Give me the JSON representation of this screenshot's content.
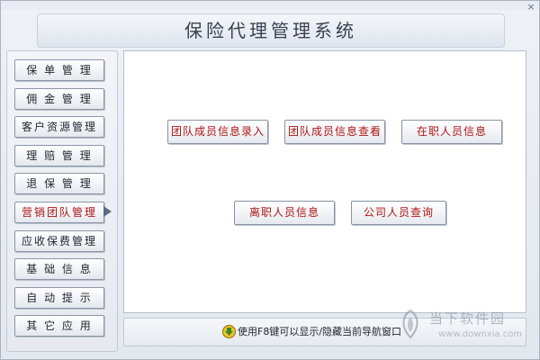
{
  "window": {
    "title": "保险代理管理系统",
    "close_glyph": "×"
  },
  "sidebar": {
    "items": [
      {
        "label": "保 单 管 理",
        "active": false
      },
      {
        "label": "佣 金 管 理",
        "active": false
      },
      {
        "label": "客户资源管理",
        "active": false
      },
      {
        "label": "理 赔 管 理",
        "active": false
      },
      {
        "label": "退 保 管 理",
        "active": false
      },
      {
        "label": "营销团队管理",
        "active": true
      },
      {
        "label": "应收保费管理",
        "active": false
      },
      {
        "label": "基 础 信 息",
        "active": false
      },
      {
        "label": "自 动 提 示",
        "active": false
      },
      {
        "label": "其 它 应 用",
        "active": false
      }
    ]
  },
  "main": {
    "buttons": [
      {
        "label": "团队成员信息录入"
      },
      {
        "label": "团队成员信息查看"
      },
      {
        "label": "在职人员信息"
      },
      {
        "label": "离职人员信息"
      },
      {
        "label": "公司人员查询"
      }
    ]
  },
  "status": {
    "text": "使用F8键可以显示/隐藏当前导航窗口",
    "icon": "download-arrow-icon"
  },
  "watermark": {
    "line1": "当下软件园",
    "line2": "www.downxia.com",
    "icon": "watermark-logo-icon"
  },
  "colors": {
    "accent_red": "#b01515",
    "text_dark": "#1f2530",
    "background": "#e7ebf1",
    "panel_white": "#ffffff"
  }
}
